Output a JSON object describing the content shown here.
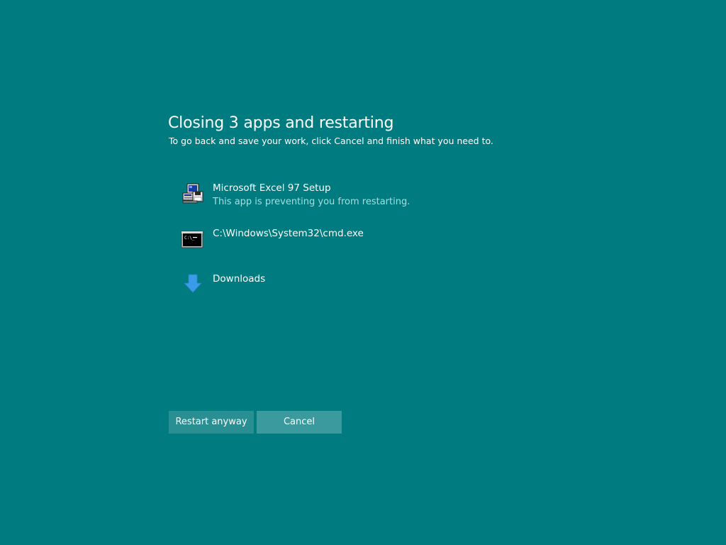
{
  "dialog": {
    "title": "Closing 3 apps and restarting",
    "subtitle": "To go back and save your work, click Cancel and finish what you need to."
  },
  "apps": [
    {
      "icon": "installer-icon",
      "name": "Microsoft Excel 97 Setup",
      "status": "This app is preventing you from restarting."
    },
    {
      "icon": "command-prompt-icon",
      "name": "C:\\Windows\\System32\\cmd.exe",
      "status": ""
    },
    {
      "icon": "download-arrow-icon",
      "name": "Downloads",
      "status": ""
    }
  ],
  "buttons": {
    "restart_label": "Restart anyway",
    "cancel_label": "Cancel"
  },
  "colors": {
    "background": "#007b80",
    "status_text": "#a4dfe0",
    "restart_button": "#2a8f93",
    "cancel_button": "#3a9a9e",
    "download_arrow": "#3a9be8"
  }
}
